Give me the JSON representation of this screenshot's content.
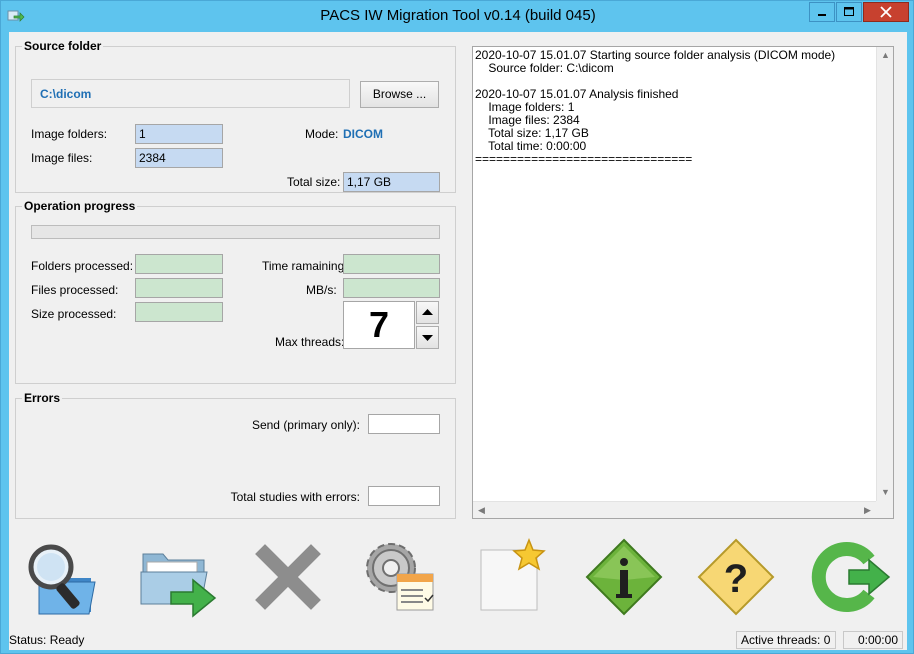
{
  "window": {
    "title": "PACS IW Migration Tool v0.14 (build 045)"
  },
  "source_folder": {
    "group_title": "Source folder",
    "path": "C:\\dicom",
    "browse_label": "Browse ...",
    "image_folders_label": "Image folders:",
    "image_folders_value": "1",
    "image_files_label": "Image files:",
    "image_files_value": "2384",
    "mode_label": "Mode:",
    "mode_value": "DICOM",
    "total_size_label": "Total size:",
    "total_size_value": "1,17 GB"
  },
  "operation_progress": {
    "group_title": "Operation progress",
    "progress_percent": 0,
    "folders_processed_label": "Folders processed:",
    "folders_processed_value": "",
    "files_processed_label": "Files processed:",
    "files_processed_value": "",
    "size_processed_label": "Size processed:",
    "size_processed_value": "",
    "time_remaining_label": "Time ramaining:",
    "time_remaining_value": "",
    "mbs_label": "MB/s:",
    "mbs_value": "",
    "max_threads_label": "Max threads:",
    "max_threads_value": "7"
  },
  "errors": {
    "group_title": "Errors",
    "send_label": "Send (primary only):",
    "send_value": "",
    "total_studies_label": "Total studies with errors:",
    "total_studies_value": ""
  },
  "log": {
    "text": "2020-10-07 15.01.07 Starting source folder analysis (DICOM mode)\n    Source folder: C:\\dicom\n\n2020-10-07 15.01.07 Analysis finished\n    Image folders: 1\n    Image files: 2384\n    Total size: 1,17 GB\n    Total time: 0:00:00\n==============================="
  },
  "toolbar": {
    "icons": [
      "analyze-folder-icon",
      "migrate-folder-icon",
      "cancel-icon",
      "settings-icon",
      "new-icon",
      "info-icon",
      "help-icon",
      "exit-icon"
    ]
  },
  "status": {
    "status_text": "Status: Ready",
    "active_threads": "Active threads: 0",
    "elapsed": "0:00:00"
  },
  "colors": {
    "titlebar": "#5ec4ee",
    "close_button": "#c7412f",
    "accent_text": "#1f6fb4",
    "blue_field": "#c6daf2",
    "green_field": "#cce6cf"
  }
}
